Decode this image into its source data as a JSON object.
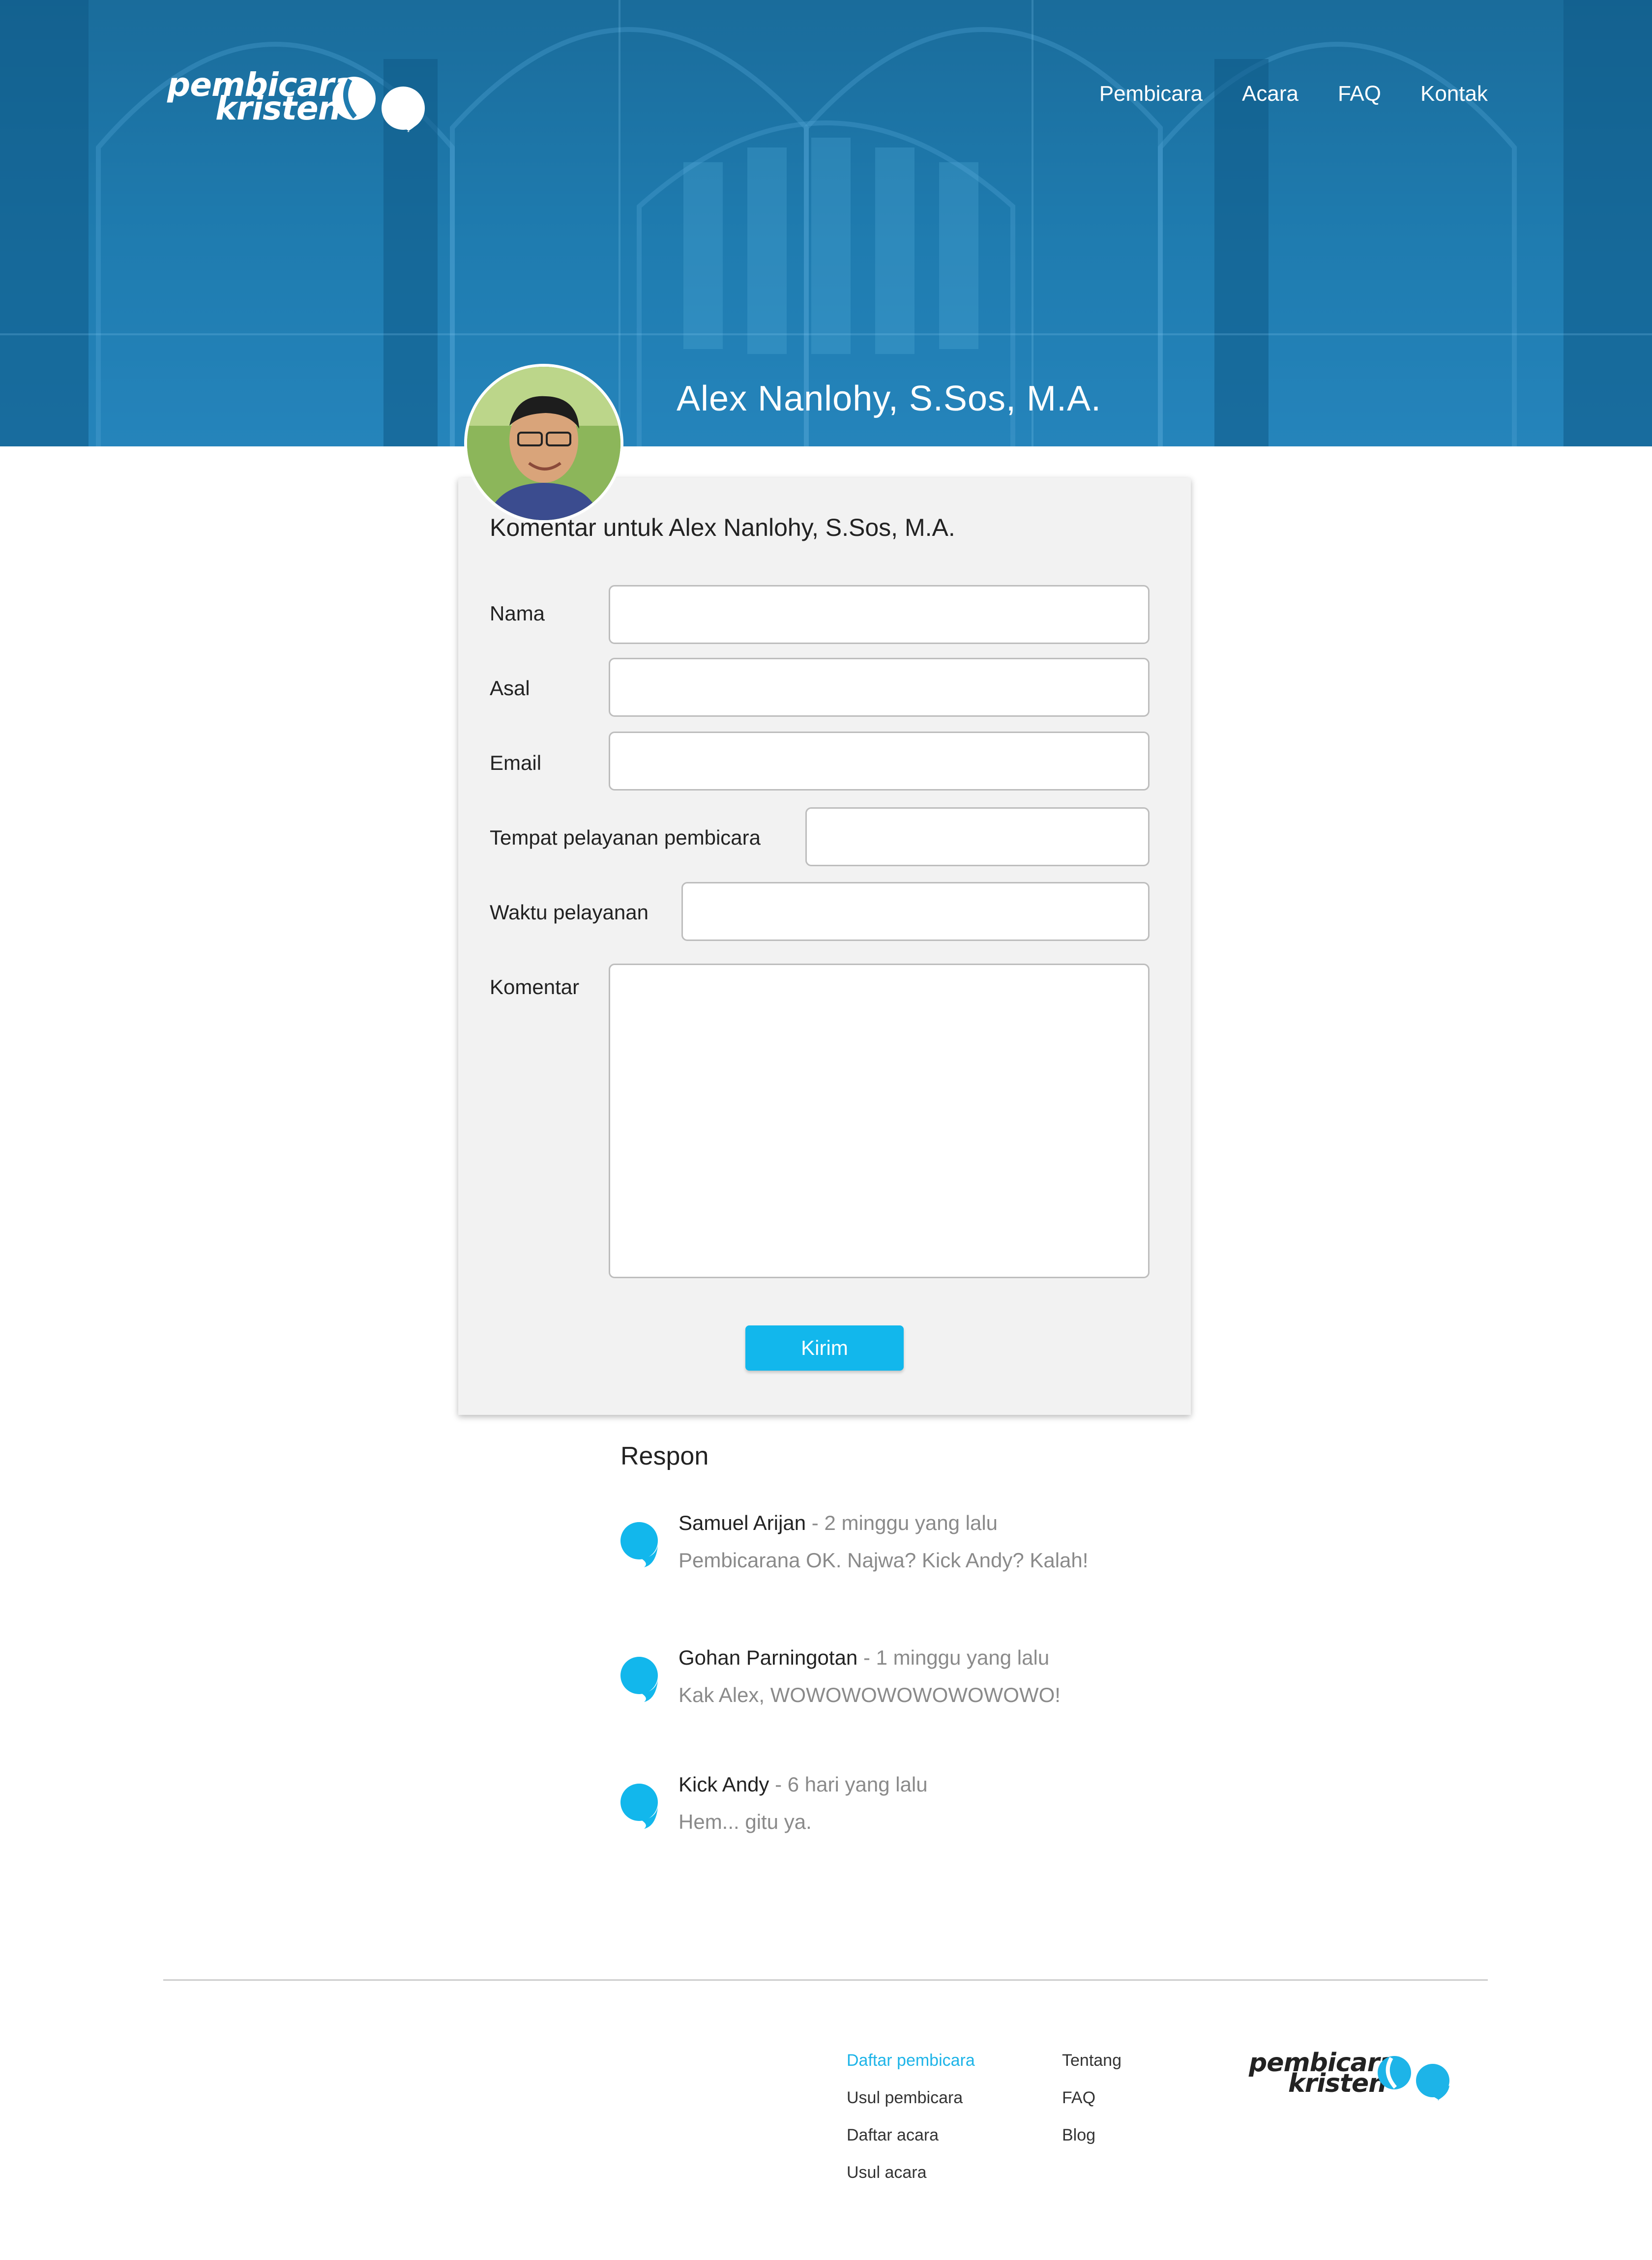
{
  "header": {
    "logo_line1": "pembicara",
    "logo_line2": "kristen",
    "nav": [
      "Pembicara",
      "Acara",
      "FAQ",
      "Kontak"
    ],
    "speaker_name": "Alex Nanlohy, S.Sos, M.A."
  },
  "form": {
    "title": "Komentar untuk Alex Nanlohy, S.Sos, M.A.",
    "labels": {
      "nama": "Nama",
      "asal": "Asal",
      "email": "Email",
      "tempat": "Tempat pelayanan pembicara",
      "waktu": "Waktu pelayanan",
      "komentar": "Komentar"
    },
    "values": {
      "nama": "",
      "asal": "",
      "email": "",
      "tempat": "",
      "waktu": "",
      "komentar": ""
    },
    "submit_label": "Kirim"
  },
  "responses": {
    "title": "Respon",
    "items": [
      {
        "name": "Samuel Arijan",
        "time": " - 2 minggu yang lalu",
        "message": "Pembicarana OK. Najwa? Kick Andy? Kalah!"
      },
      {
        "name": "Gohan Parningotan",
        "time": " - 1 minggu yang lalu",
        "message": "Kak Alex, WOWOWOWOWOWOWOWO!"
      },
      {
        "name": "Kick Andy",
        "time": " - 6 hari yang lalu",
        "message": "Hem... gitu ya."
      }
    ]
  },
  "footer": {
    "col1": [
      "Daftar pembicara",
      "Usul pembicara",
      "Daftar acara",
      "Usul acara"
    ],
    "col2": [
      "Tentang",
      "FAQ",
      "Blog"
    ],
    "logo_line1": "pembicara",
    "logo_line2": "kristen"
  },
  "colors": {
    "hero_blue": "#1f7cb0",
    "accent": "#12b7ec",
    "card_bg": "#f2f2f2"
  }
}
